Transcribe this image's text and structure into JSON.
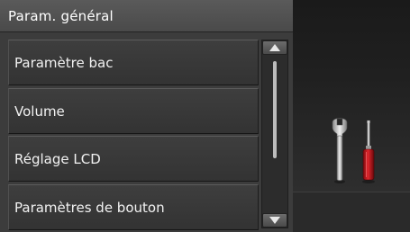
{
  "header": {
    "title": "Param. général"
  },
  "menu": {
    "items": [
      {
        "label": "Paramètre bac"
      },
      {
        "label": "Volume"
      },
      {
        "label": "Réglage LCD"
      },
      {
        "label": "Paramètres de bouton"
      }
    ]
  },
  "scrollbar": {
    "up_icon": "triangle-up-icon",
    "down_icon": "triangle-down-icon"
  },
  "illustration": {
    "icons": [
      "wrench-icon",
      "screwdriver-icon"
    ],
    "accent_color": "#c8171c"
  }
}
